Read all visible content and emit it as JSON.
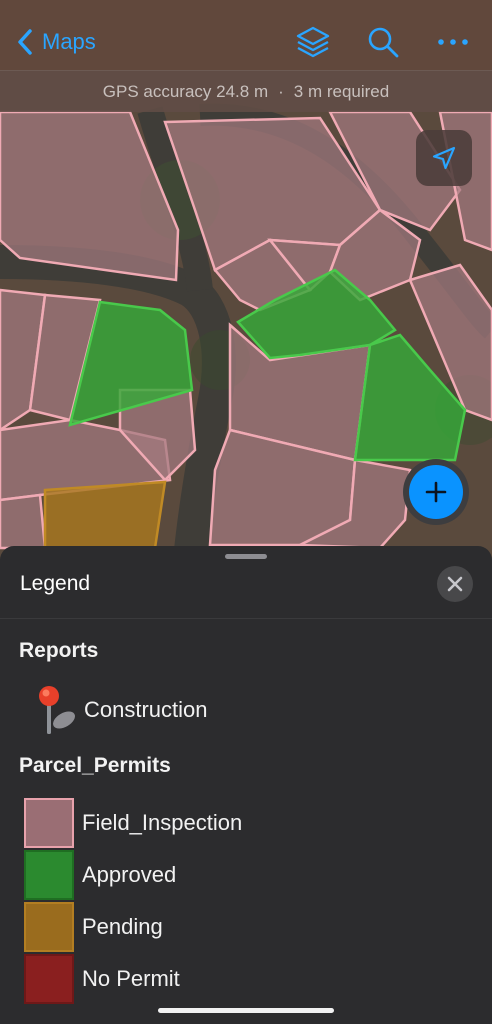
{
  "header": {
    "back_label": "Maps",
    "icons": [
      "chevron-left-icon",
      "layers-icon",
      "search-icon",
      "more-icon"
    ],
    "accent_color": "#2aa5ff"
  },
  "gps": {
    "accuracy_text": "GPS accuracy 24.8 m",
    "separator": "·",
    "required_text": "3 m required"
  },
  "map_controls": {
    "locate_icon": "location-arrow-icon",
    "add_icon": "plus-icon",
    "add_color": "#0a93ff"
  },
  "legend": {
    "title": "Legend",
    "close_icon": "close-icon",
    "groups": [
      {
        "title": "Reports",
        "items": [
          {
            "label": "Construction",
            "icon": "pin-icon"
          }
        ]
      },
      {
        "title": "Parcel_Permits",
        "items": [
          {
            "label": "Field_Inspection",
            "fill": "#9a6e74",
            "stroke": "#e8a2ac"
          },
          {
            "label": "Approved",
            "fill": "#2b8a2f",
            "stroke": "#1f6e22"
          },
          {
            "label": "Pending",
            "fill": "#9a6c1e",
            "stroke": "#b37e22"
          },
          {
            "label": "No Permit",
            "fill": "#8a1f1f",
            "stroke": "#6e1818"
          }
        ]
      }
    ]
  }
}
